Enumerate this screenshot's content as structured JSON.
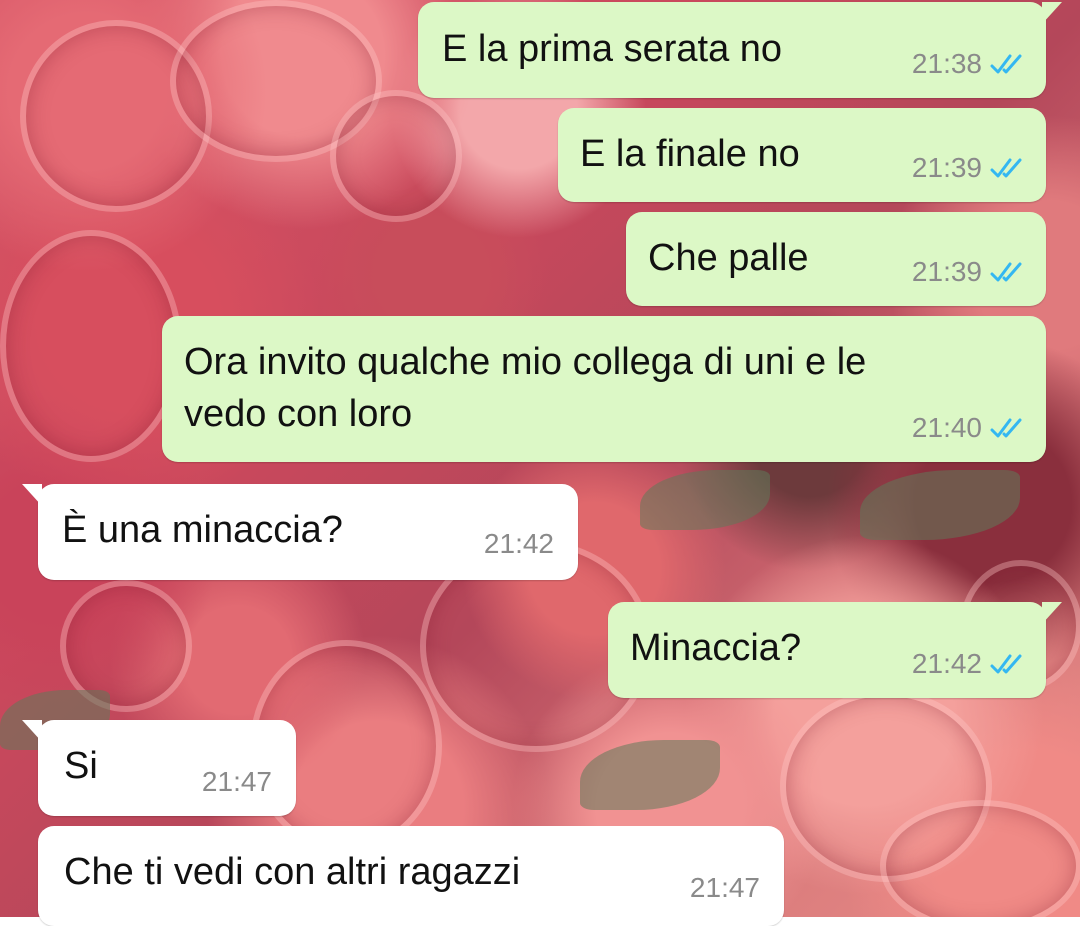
{
  "colors": {
    "outgoing_bubble": "#dcf8c6",
    "incoming_bubble": "#ffffff",
    "timestamp": "#8a8a8a",
    "read_ticks": "#34b7f1"
  },
  "messages": [
    {
      "direction": "outgoing",
      "text": "E la prima serata no",
      "time": "21:38",
      "status": "read-ticks-icon"
    },
    {
      "direction": "outgoing",
      "text": "E la finale no",
      "time": "21:39",
      "status": "read-ticks-icon"
    },
    {
      "direction": "outgoing",
      "text": "Che palle",
      "time": "21:39",
      "status": "read-ticks-icon"
    },
    {
      "direction": "outgoing",
      "text_line1": "Ora invito qualche mio collega di uni e le",
      "text_line2": "vedo con loro",
      "time": "21:40",
      "status": "read-ticks-icon"
    },
    {
      "direction": "incoming",
      "text": "È una minaccia?",
      "time": "21:42"
    },
    {
      "direction": "outgoing",
      "text": "Minaccia?",
      "time": "21:42",
      "status": "read-ticks-icon"
    },
    {
      "direction": "incoming",
      "text": "Si",
      "time": "21:47"
    },
    {
      "direction": "incoming",
      "text": "Che ti vedi con altri ragazzi",
      "time": "21:47"
    }
  ]
}
